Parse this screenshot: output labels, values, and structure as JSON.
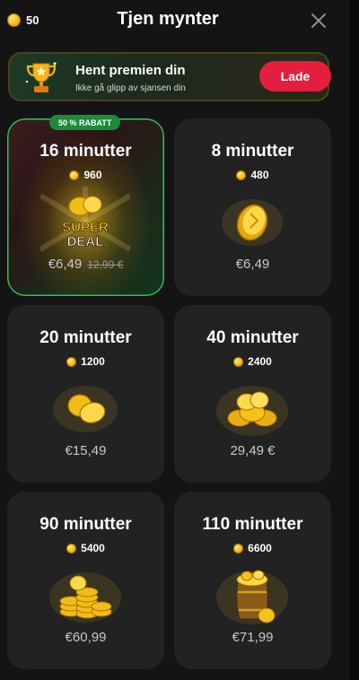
{
  "header": {
    "balance": "50",
    "title": "Tjen mynter"
  },
  "banner": {
    "title": "Hent premien din",
    "subtitle": "Ikke gå glipp av sjansen din",
    "button": "Lade"
  },
  "offers": [
    {
      "duration": "16 minutter",
      "coins": "960",
      "price": "€6,49",
      "old_price": "12,99 €",
      "badge": "50 % RABATT",
      "image": "super-deal",
      "image_text_1": "SUPER",
      "image_text_2": "DEAL"
    },
    {
      "duration": "8 minutter",
      "coins": "480",
      "price": "€6,49",
      "image": "single-coin"
    },
    {
      "duration": "20 minutter",
      "coins": "1200",
      "price": "€15,49",
      "image": "two-coins"
    },
    {
      "duration": "40 minutter",
      "coins": "2400",
      "price": "29,49 €",
      "image": "coin-pile"
    },
    {
      "duration": "90 minutter",
      "coins": "5400",
      "price": "€60,99",
      "image": "coin-stacks"
    },
    {
      "duration": "110 minutter",
      "coins": "6600",
      "price": "€71,99",
      "image": "coin-barrel"
    }
  ],
  "colors": {
    "background": "#141414",
    "card": "#222222",
    "accent_red": "#e51e3f",
    "badge_green": "#1e8a3a",
    "coin_gold": "#f6c21a"
  }
}
